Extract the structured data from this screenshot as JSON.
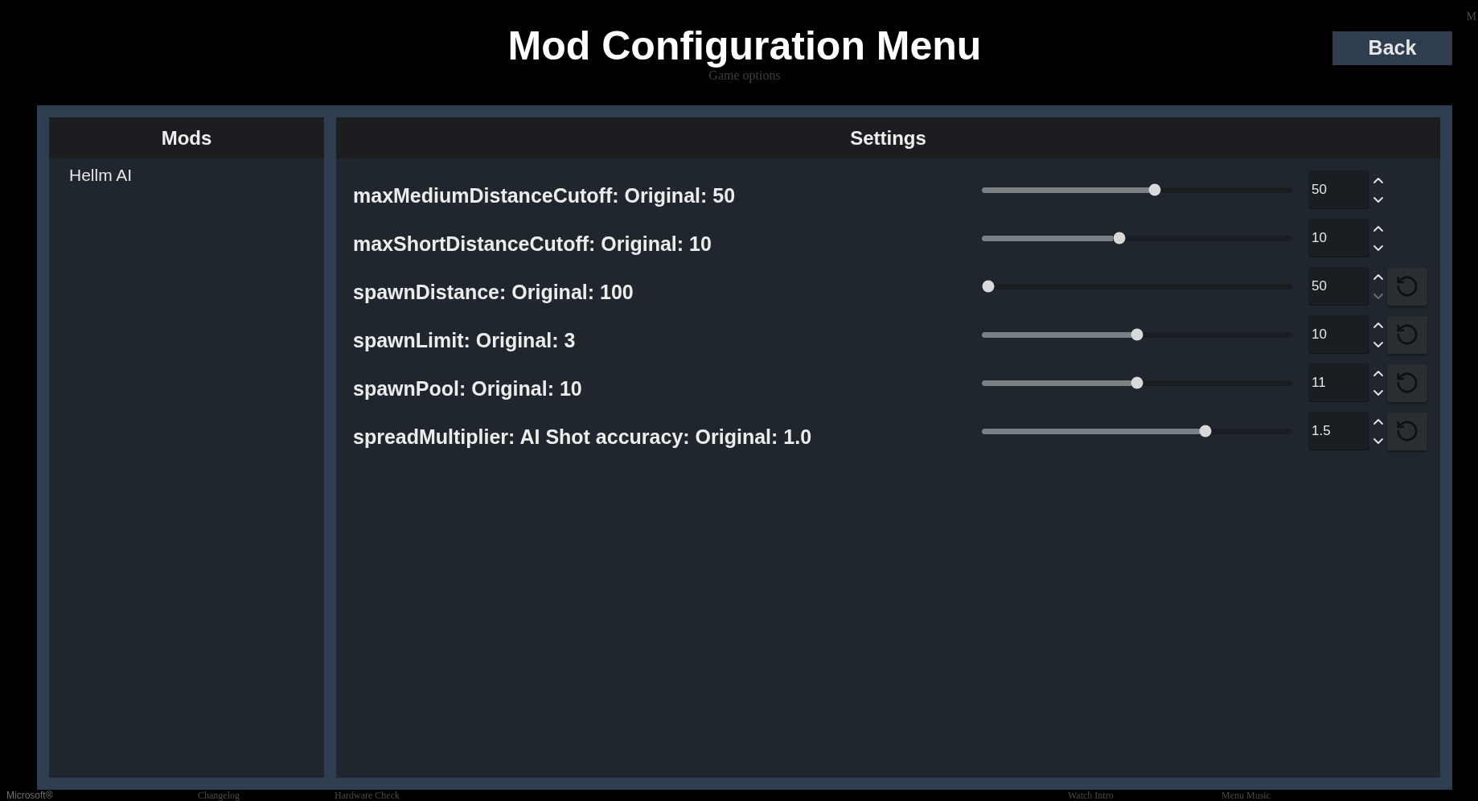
{
  "title": "Mod Configuration Menu",
  "back_button": "Back",
  "background_menu": {
    "subtitle": "Game options",
    "corner_text": "M",
    "footer_items": [
      "Microsoft®",
      "Changelog",
      "Hardware Check",
      "Watch Intro",
      "Menu Music"
    ]
  },
  "mods_panel": {
    "header": "Mods",
    "items": [
      {
        "label": "Hellm AI"
      }
    ]
  },
  "settings_panel": {
    "header": "Settings",
    "settings": [
      {
        "label": "maxMediumDistanceCutoff: Original: 50",
        "level": 0.56,
        "value": "50",
        "decrement_disabled": false,
        "resettable": false
      },
      {
        "label": "maxShortDistanceCutoff: Original: 10",
        "level": 0.44,
        "value": "10",
        "decrement_disabled": false,
        "resettable": false
      },
      {
        "label": "spawnDistance: Original: 100",
        "level": 0,
        "value": "50",
        "decrement_disabled": true,
        "resettable": true
      },
      {
        "label": "spawnLimit: Original: 3",
        "level": 0.5,
        "value": "10",
        "decrement_disabled": false,
        "resettable": true
      },
      {
        "label": "spawnPool: Original: 10",
        "level": 0.5,
        "value": "11",
        "decrement_disabled": false,
        "resettable": true
      },
      {
        "label": "spreadMultiplier: AI Shot accuracy: Original: 1.0",
        "level": 0.73,
        "value": "1.5",
        "decrement_disabled": false,
        "resettable": true
      }
    ]
  }
}
